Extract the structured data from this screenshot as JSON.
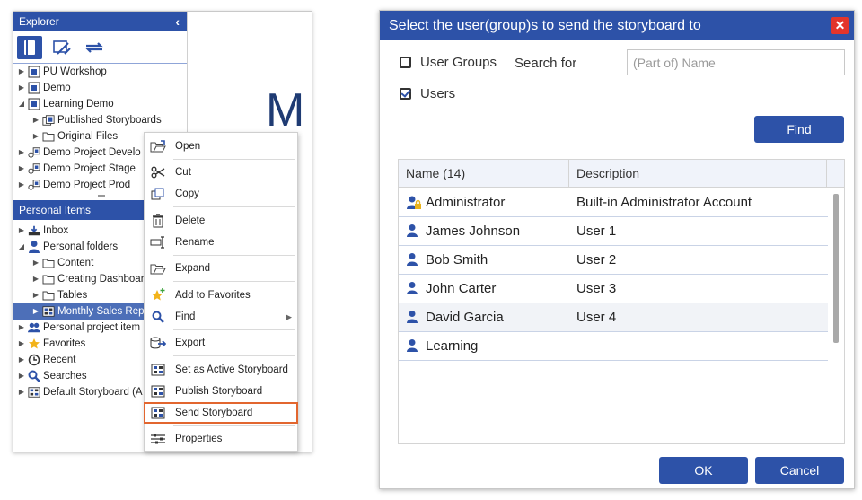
{
  "explorer": {
    "title": "Explorer",
    "tree": [
      {
        "label": "PU Workshop",
        "icon": "project-icon",
        "expanded": false,
        "indent": 0
      },
      {
        "label": "Demo",
        "icon": "project-icon",
        "expanded": false,
        "indent": 0
      },
      {
        "label": "Learning Demo",
        "icon": "project-icon",
        "expanded": true,
        "indent": 0
      },
      {
        "label": "Published Storyboards",
        "icon": "published-storyboards-icon",
        "expanded": false,
        "indent": 1
      },
      {
        "label": "Original Files",
        "icon": "folder-icon",
        "expanded": false,
        "indent": 1
      },
      {
        "label": "Demo Project Develo",
        "icon": "project-group-icon",
        "expanded": false,
        "indent": 0
      },
      {
        "label": "Demo Project Stage",
        "icon": "project-group-icon",
        "expanded": false,
        "indent": 0
      },
      {
        "label": "Demo Project Prod",
        "icon": "project-group-icon",
        "expanded": false,
        "indent": 0
      }
    ],
    "personal_header": "Personal Items",
    "personal_tree": [
      {
        "label": "Inbox",
        "icon": "inbox-icon",
        "expanded": false,
        "indent": 0
      },
      {
        "label": "Personal folders",
        "icon": "user-icon",
        "expanded": true,
        "indent": 0
      },
      {
        "label": "Content",
        "icon": "folder-icon",
        "expanded": false,
        "indent": 1
      },
      {
        "label": "Creating Dashboar",
        "icon": "folder-icon",
        "expanded": false,
        "indent": 1
      },
      {
        "label": "Tables",
        "icon": "folder-icon",
        "expanded": false,
        "indent": 1
      },
      {
        "label": "Monthly Sales Rep",
        "icon": "storyboard-icon",
        "expanded": false,
        "indent": 1,
        "selected": true
      },
      {
        "label": "Personal project item",
        "icon": "users-icon",
        "expanded": false,
        "indent": 0
      },
      {
        "label": "Favorites",
        "icon": "star-icon",
        "expanded": false,
        "indent": 0
      },
      {
        "label": "Recent",
        "icon": "clock-icon",
        "expanded": false,
        "indent": 0
      },
      {
        "label": "Searches",
        "icon": "search-icon",
        "expanded": false,
        "indent": 0
      },
      {
        "label": "Default Storyboard (A",
        "icon": "storyboard-icon",
        "expanded": false,
        "indent": 0
      }
    ],
    "canvas_text": "M"
  },
  "context_menu": {
    "items": [
      {
        "label": "Open",
        "icon": "open-folder-icon"
      },
      {
        "label": "Cut",
        "icon": "scissors-icon"
      },
      {
        "label": "Copy",
        "icon": "copy-icon"
      },
      {
        "label": "Delete",
        "icon": "trash-icon"
      },
      {
        "label": "Rename",
        "icon": "rename-icon"
      },
      {
        "label": "Expand",
        "icon": "expand-folder-icon"
      },
      {
        "label": "Add to Favorites",
        "icon": "star-add-icon"
      },
      {
        "label": "Find",
        "icon": "search-icon"
      },
      {
        "label": "Export",
        "icon": "export-icon"
      },
      {
        "label": "Set as Active Storyboard",
        "icon": "storyboard-icon"
      },
      {
        "label": "Publish Storyboard",
        "icon": "storyboard-icon"
      },
      {
        "label": "Send Storyboard",
        "icon": "storyboard-icon"
      },
      {
        "label": "Properties",
        "icon": "properties-icon"
      }
    ]
  },
  "dialog": {
    "title": "Select the user(group)s to send the storyboard to",
    "user_groups_label": "User Groups",
    "user_groups_checked": false,
    "users_label": "Users",
    "users_checked": true,
    "search_label": "Search for",
    "search_placeholder": "(Part of) Name",
    "search_value": "",
    "find_label": "Find",
    "columns": [
      "Name (14)",
      "Description"
    ],
    "rows": [
      {
        "name": "Administrator",
        "description": "Built-in Administrator Account",
        "icon": "admin-user-icon"
      },
      {
        "name": "James Johnson",
        "description": "User 1",
        "icon": "user-icon"
      },
      {
        "name": "Bob Smith",
        "description": "User 2",
        "icon": "user-icon"
      },
      {
        "name": "John Carter",
        "description": "User 3",
        "icon": "user-icon"
      },
      {
        "name": "David Garcia",
        "description": "User 4",
        "icon": "user-icon"
      },
      {
        "name": "Learning",
        "description": "",
        "icon": "user-icon"
      }
    ],
    "ok_label": "OK",
    "cancel_label": "Cancel"
  },
  "colors": {
    "accent": "#2d52a8",
    "highlight_outline": "#e2662f",
    "close_button": "#e3352b"
  }
}
